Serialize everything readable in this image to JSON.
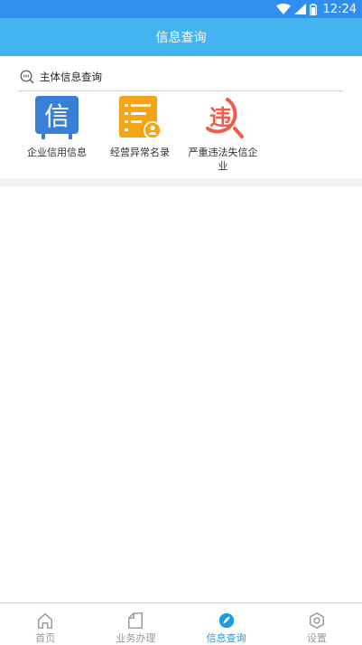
{
  "status_bar": {
    "time": "12:24",
    "bg_color": "#2f8ef0"
  },
  "app_bar": {
    "title": "信息查询",
    "bg_color": "#44b4ee"
  },
  "section": {
    "icon": "search-magnifier-icon",
    "title": "主体信息查询"
  },
  "tiles": [
    {
      "label": "企业信用信息",
      "icon": "credit-info-icon",
      "glyph": "信",
      "color": "#3a7fd6"
    },
    {
      "label": "经营异常名录",
      "icon": "abnormal-list-icon",
      "color": "#f5a417"
    },
    {
      "label": "严重违法失信企业",
      "icon": "serious-violation-icon",
      "glyph": "违",
      "color": "#ef5c4b"
    }
  ],
  "tab_bar": {
    "tabs": [
      {
        "label": "首页",
        "icon": "home-icon",
        "active": false
      },
      {
        "label": "业务办理",
        "icon": "document-icon",
        "active": false
      },
      {
        "label": "信息查询",
        "icon": "info-query-icon",
        "active": true
      },
      {
        "label": "设置",
        "icon": "settings-icon",
        "active": false
      }
    ],
    "active_color": "#1a9be6",
    "inactive_color": "#999999"
  }
}
